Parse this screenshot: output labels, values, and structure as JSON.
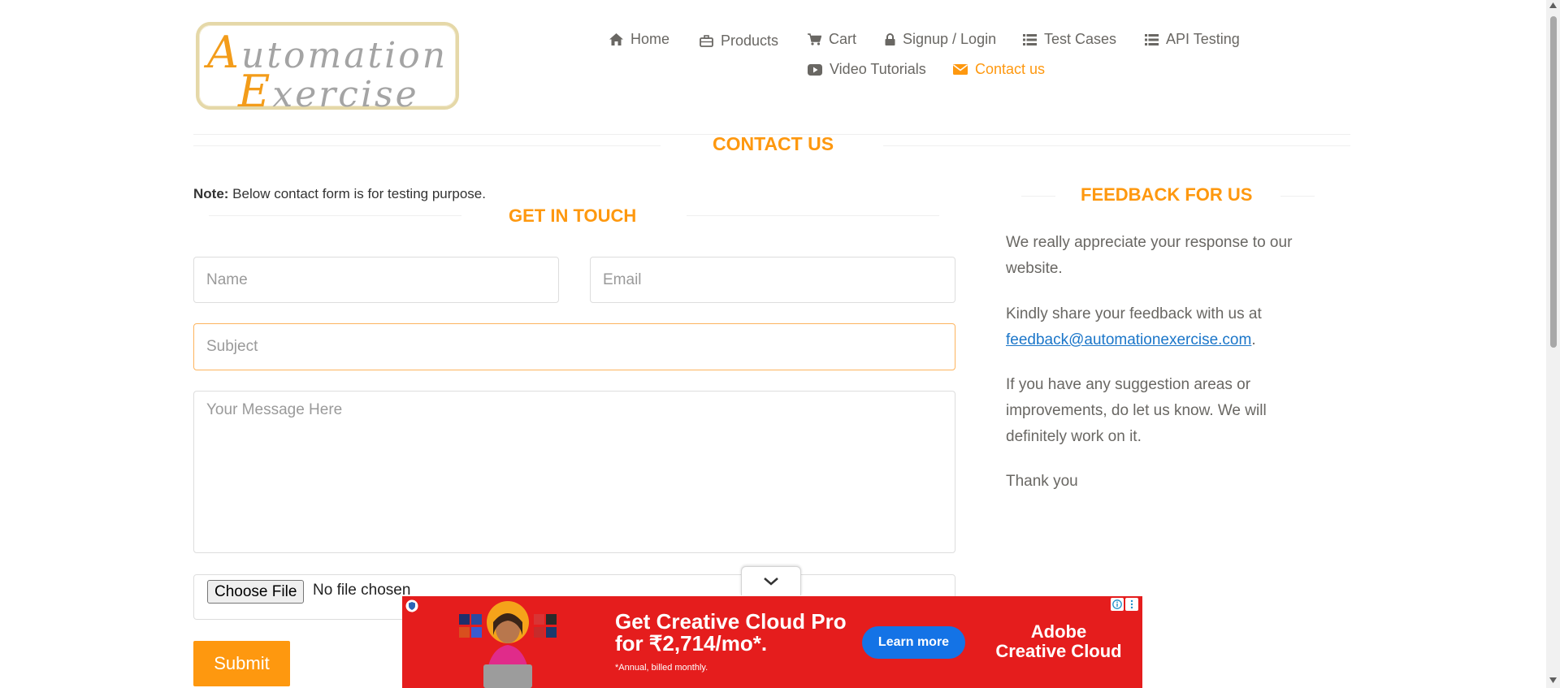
{
  "logo": {
    "line1_cap": "A",
    "line1_rest": "utomation",
    "line2_cap": "E",
    "line2_rest": "xercise"
  },
  "nav": {
    "home": "Home",
    "products": "Products",
    "cart": "Cart",
    "signup": "Signup / Login",
    "test_cases": "Test Cases",
    "api_testing": "API Testing",
    "video_tutorials": "Video Tutorials",
    "contact_us": "Contact us"
  },
  "page_title": "Contact Us",
  "note": {
    "label": "Note:",
    "text": " Below contact form is for testing purpose."
  },
  "form": {
    "title": "Get In Touch",
    "name_placeholder": "Name",
    "email_placeholder": "Email",
    "subject_placeholder": "Subject",
    "message_placeholder": "Your Message Here",
    "choose_file": "Choose File",
    "no_file": "No file chosen",
    "submit": "Submit"
  },
  "feedback": {
    "title": "Feedback For Us",
    "p1": "We really appreciate your response to our website.",
    "p2_text": "Kindly share your feedback with us at ",
    "p2_email": "feedback@automationexercise.com",
    "p2_end": ".",
    "p3": "If you have any suggestion areas or improvements, do let us know. We will definitely work on it.",
    "p4": "Thank you"
  },
  "ad": {
    "headline_1": "Get Creative Cloud Pro",
    "headline_2": "for ₹2,714/mo*.",
    "subtext": "*Annual, billed monthly.",
    "cta": "Learn more",
    "brand_1": "Adobe",
    "brand_2": "Creative Cloud"
  },
  "colors": {
    "accent": "#fe980f",
    "text": "#696763",
    "link": "#1b76c9",
    "ad_bg": "#e51d1d",
    "ad_button": "#1473e6"
  }
}
